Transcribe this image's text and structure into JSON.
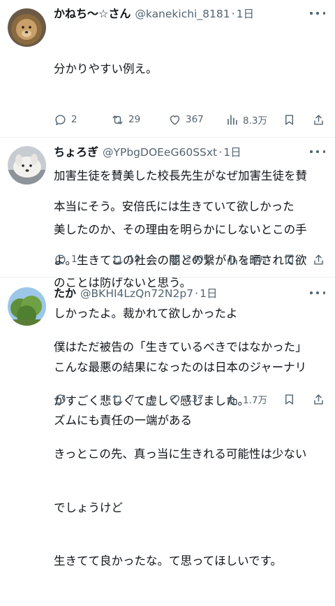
{
  "posts": [
    {
      "name": "かねち〜☆さん",
      "handle": "@kanekichi_8181",
      "separator": "·",
      "time": "1日",
      "lines": [
        "分かりやすい例え。",
        "",
        "加害生徒を賛美した校長先生がなぜ加害生徒を賛",
        "美したのか、その理由を明らかにしないとこの手",
        "のことは防げないと思う。"
      ],
      "replies": "2",
      "reposts": "29",
      "likes": "367",
      "views": "8.3万",
      "avatar": "lion-avatar"
    },
    {
      "name": "ちょろぎ",
      "handle": "@YPbgDOEeG60SSxt",
      "separator": "·",
      "time": "1日",
      "lines": [
        "本当にそう。安倍氏には生きていて欲しかった",
        "よ。生きてこの社会の闇との繋がりを晒されて欲",
        "しかったよ。裁かれて欲しかったよ",
        "こんな最悪の結果になったのは日本のジャーナリ",
        "ズムにも責任の一端がある"
      ],
      "replies": "1",
      "reposts": "19",
      "likes": "240",
      "views": "1.5万",
      "avatar": "dog-avatar"
    },
    {
      "name": "たか",
      "handle": "@BKHI4LzQn72N2p7",
      "separator": "·",
      "time": "1日",
      "lines": [
        "僕はただ被告の「生きているべきではなかった」",
        "がすごく悲しくて虚しく感じました。",
        "きっとこの先、真っ当に生きれる可能性は少ない",
        "でしょうけど",
        "生きてて良かったな。て思ってほしいです。"
      ],
      "replies": "",
      "reposts": "7",
      "likes": "137",
      "views": "1.7万",
      "avatar": "tree-avatar"
    }
  ]
}
